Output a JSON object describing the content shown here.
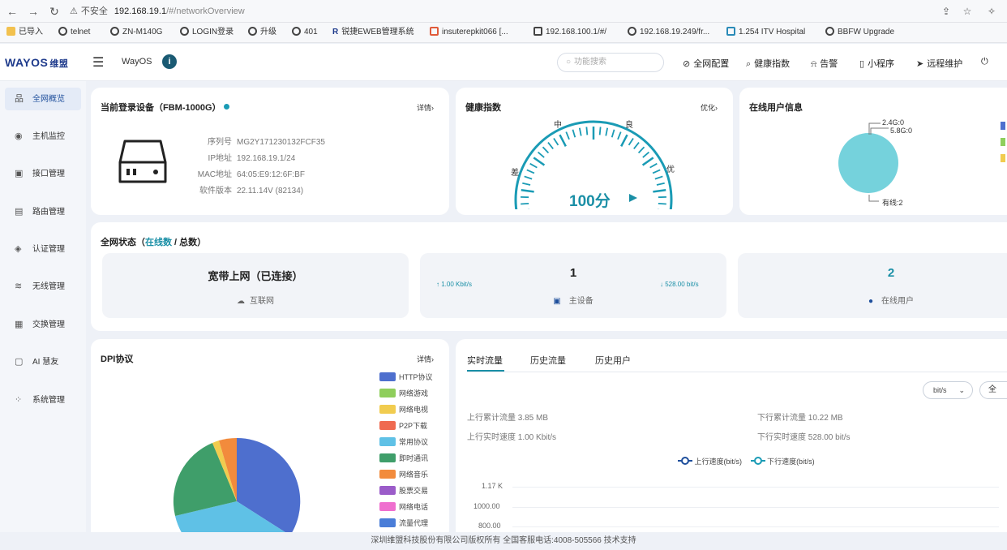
{
  "browser": {
    "url_warning": "⚠",
    "url_insecure": "不安全",
    "url_host": "192.168.19.1",
    "url_path": "/#/networkOverview",
    "bookmarks": [
      "已导入",
      "telnet",
      "ZN-M140G",
      "LOGIN登录",
      "升级",
      "401",
      "锐捷EWEB管理系统",
      "insuterepkit066 [...",
      "192.168.100.1/#/",
      "192.168.19.249/fr...",
      "1.254 ITV Hospital",
      "BBFW Upgrade"
    ]
  },
  "header": {
    "logo": "WAYOS",
    "logo_cn": "维盟",
    "app_name": "WayOS",
    "version_badge": "i",
    "search_placeholder": "功能搜索",
    "links": [
      "全网配置",
      "健康指数",
      "告警",
      "小程序",
      "远程维护"
    ]
  },
  "sidebar": {
    "items": [
      {
        "label": "全网概览",
        "icon": "network-icon",
        "glyph": "品"
      },
      {
        "label": "主机监控",
        "icon": "monitor-icon",
        "glyph": "◉"
      },
      {
        "label": "接口管理",
        "icon": "interface-icon",
        "glyph": "▣"
      },
      {
        "label": "路由管理",
        "icon": "router-icon",
        "glyph": "▤"
      },
      {
        "label": "认证管理",
        "icon": "shield-icon",
        "glyph": "◈"
      },
      {
        "label": "无线管理",
        "icon": "wifi-icon",
        "glyph": "≋"
      },
      {
        "label": "交换管理",
        "icon": "switch-icon",
        "glyph": "▦"
      },
      {
        "label": "AI 慧友",
        "icon": "ai-icon",
        "glyph": "▢"
      },
      {
        "label": "系统管理",
        "icon": "settings-icon",
        "glyph": "⁘"
      }
    ]
  },
  "device": {
    "title": "当前登录设备（FBM-1000G）",
    "detail_link": "详情›",
    "rows": [
      {
        "k": "序列号",
        "v": "MG2Y171230132FCF35"
      },
      {
        "k": "IP地址",
        "v": "192.168.19.1/24"
      },
      {
        "k": "MAC地址",
        "v": "64:05:E9:12:6F:BF"
      },
      {
        "k": "软件版本",
        "v": "22.11.14V (82134)"
      }
    ]
  },
  "health": {
    "title": "健康指数",
    "link": "优化›",
    "label_bad": "差",
    "label_mid": "中",
    "label_good": "良",
    "label_best": "优",
    "score": "100分",
    "score_value": 100
  },
  "online_users": {
    "title": "在线用户信息",
    "label_24g": "2.4G:0",
    "label_58g": "5.8G:0",
    "label_wired": "有线:2"
  },
  "network_status": {
    "title_prefix": "全网状态（",
    "title_online": "在线数",
    "title_suffix": " / 总数）",
    "wan_title": "宽带上网（已连接）",
    "wan_sub": "互联网",
    "up_rate": "↑ 1.00 Kbit/s",
    "down_rate": "↓ 528.00 bit/s",
    "main_device_count": "1",
    "main_device_label": "主设备",
    "online_user_count": "2",
    "online_user_label": "在线用户"
  },
  "dpi": {
    "title": "DPI协议",
    "link": "详情›",
    "legend": [
      {
        "label": "HTTP协议",
        "color": "#4e6fce"
      },
      {
        "label": "网络游戏",
        "color": "#8fce5c"
      },
      {
        "label": "网络电视",
        "color": "#f1cc4f"
      },
      {
        "label": "P2P下载",
        "color": "#ef6a50"
      },
      {
        "label": "常用协议",
        "color": "#5fc1e6"
      },
      {
        "label": "即时通讯",
        "color": "#3f9e6a"
      },
      {
        "label": "网络音乐",
        "color": "#f28b3c"
      },
      {
        "label": "股票交易",
        "color": "#9b5cc9"
      },
      {
        "label": "网络电话",
        "color": "#ef6fcf"
      },
      {
        "label": "流量代理",
        "color": "#4a7dd8"
      }
    ]
  },
  "traffic": {
    "tabs": [
      "实时流量",
      "历史流量",
      "历史用户"
    ],
    "unit_select": "bit/s",
    "all_button": "全",
    "up_total": "上行累计流量 3.85 MB",
    "up_rate": "上行实时速度 1.00 Kbit/s",
    "down_total": "下行累计流量 10.22 MB",
    "down_rate": "下行实时速度 528.00 bit/s",
    "legend_up": "上行速度(bit/s)",
    "legend_down": "下行速度(bit/s)",
    "y_ticks": [
      "1.17 K",
      "1000.00",
      "800.00"
    ]
  },
  "footer": {
    "text": "深圳维盟科技股份有限公司版权所有   全国客服电话:4008-505566   技术支持"
  },
  "colors": {
    "accent": "#1a8fa6",
    "gauge": "#1a9bb5",
    "online_user_circle": "#75d2dc"
  }
}
